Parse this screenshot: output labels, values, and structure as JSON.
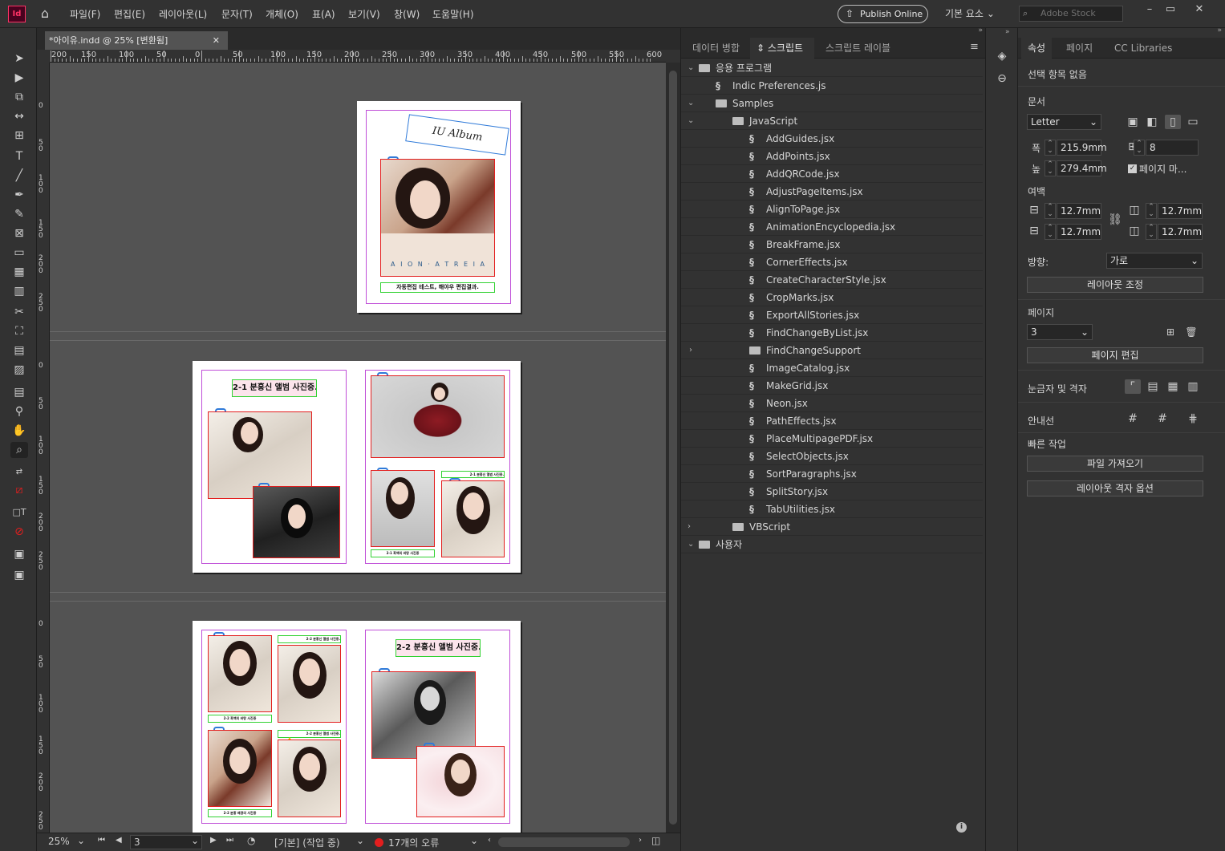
{
  "app": {
    "logo": "Id",
    "home_icon": "home-icon"
  },
  "menu": [
    "파일(F)",
    "편집(E)",
    "레이아웃(L)",
    "문자(T)",
    "개체(O)",
    "표(A)",
    "보기(V)",
    "창(W)",
    "도움말(H)"
  ],
  "publish_label": "Publish Online",
  "workspace_label": "기본 요소",
  "stock_placeholder": "Adobe Stock",
  "document": {
    "tab_title": "*아이유.indd @ 25% [변환됨]",
    "ruler_labels": [
      "200",
      "150",
      "100",
      "50",
      "0",
      "50",
      "100",
      "150",
      "200",
      "250",
      "300",
      "350",
      "400",
      "450",
      "500",
      "550",
      "600"
    ],
    "page1_title": "IU Album",
    "page1_caption_strip": "A I O N · A T R E I A",
    "page1_text": "자동편집 테스트, 해야우 편집결과.",
    "spread2_title": "2-1 분홍신 앨범 사진중...",
    "spread2_small_right": "2-1 분홍신 앨범 사진중.",
    "spread2_small_left": "2-1 흑백의 바탕 사진중",
    "spread3_title": "2-2 분홍신 앨범 사진중...",
    "spread3_small1": "2-2 분홍신 앨범 사진중.",
    "spread3_small2": "2-2 흑백의 바탕 사진중",
    "spread3_small3": "2-2 분홍신 앨범 사진중.",
    "spread3_small4": "2-2 분홍 배경의 사진중"
  },
  "status": {
    "zoom": "25%",
    "page": "3",
    "style": "[기본] (작업 중)",
    "errors": "17개의 오류",
    "error_color": "#e31e1e"
  },
  "scripts_panel": {
    "tabs": [
      "데이터 병합",
      "스크립트",
      "스크립트 레이블"
    ],
    "active_tab": "스크립트",
    "tree": [
      {
        "label": "응용 프로그램",
        "type": "folder",
        "level": 0,
        "expanded": true
      },
      {
        "label": "Indic Preferences.js",
        "type": "js",
        "level": 1
      },
      {
        "label": "Samples",
        "type": "folder",
        "level": 1,
        "expanded": true
      },
      {
        "label": "JavaScript",
        "type": "folder",
        "level": 2,
        "expanded": true
      },
      {
        "label": "AddGuides.jsx",
        "type": "js",
        "level": 3
      },
      {
        "label": "AddPoints.jsx",
        "type": "js",
        "level": 3
      },
      {
        "label": "AddQRCode.jsx",
        "type": "js",
        "level": 3
      },
      {
        "label": "AdjustPageItems.jsx",
        "type": "js",
        "level": 3
      },
      {
        "label": "AlignToPage.jsx",
        "type": "js",
        "level": 3
      },
      {
        "label": "AnimationEncyclopedia.jsx",
        "type": "js",
        "level": 3
      },
      {
        "label": "BreakFrame.jsx",
        "type": "js",
        "level": 3
      },
      {
        "label": "CornerEffects.jsx",
        "type": "js",
        "level": 3
      },
      {
        "label": "CreateCharacterStyle.jsx",
        "type": "js",
        "level": 3
      },
      {
        "label": "CropMarks.jsx",
        "type": "js",
        "level": 3
      },
      {
        "label": "ExportAllStories.jsx",
        "type": "js",
        "level": 3
      },
      {
        "label": "FindChangeByList.jsx",
        "type": "js",
        "level": 3
      },
      {
        "label": "FindChangeSupport",
        "type": "folder",
        "level": 3,
        "expanded": false
      },
      {
        "label": "ImageCatalog.jsx",
        "type": "js",
        "level": 3
      },
      {
        "label": "MakeGrid.jsx",
        "type": "js",
        "level": 3
      },
      {
        "label": "Neon.jsx",
        "type": "js",
        "level": 3
      },
      {
        "label": "PathEffects.jsx",
        "type": "js",
        "level": 3
      },
      {
        "label": "PlaceMultipagePDF.jsx",
        "type": "js",
        "level": 3
      },
      {
        "label": "SelectObjects.jsx",
        "type": "js",
        "level": 3
      },
      {
        "label": "SortParagraphs.jsx",
        "type": "js",
        "level": 3
      },
      {
        "label": "SplitStory.jsx",
        "type": "js",
        "level": 3
      },
      {
        "label": "TabUtilities.jsx",
        "type": "js",
        "level": 3
      },
      {
        "label": "VBScript",
        "type": "folder",
        "level": 2,
        "expanded": false
      },
      {
        "label": "사용자",
        "type": "folder",
        "level": 0,
        "expanded": true
      }
    ]
  },
  "properties": {
    "tabs": [
      "속성",
      "페이지",
      "CC Libraries"
    ],
    "no_selection": "선택 항목 없음",
    "document_label": "문서",
    "page_size": "Letter",
    "width_label": "폭",
    "width": "215.9mm",
    "height_label": "높",
    "height": "279.4mm",
    "pages_count": "8",
    "facing_pages_label": "페이지 마...",
    "margins_label": "여백",
    "margin_top": "12.7mm",
    "margin_bottom": "12.7mm",
    "margin_inside": "12.7mm",
    "margin_outside": "12.7mm",
    "orientation_label": "방향:",
    "orientation": "가로",
    "adjust_layout_btn": "레이아웃 조정",
    "page_label": "페이지",
    "page_value": "3",
    "edit_page_btn": "페이지 편집",
    "rulers_label": "눈금자 및 격자",
    "guides_label": "안내선",
    "quick_actions_label": "빠른 작업",
    "import_file_btn": "파일 가져오기",
    "layout_grid_btn": "레이아웃 격자 옵션"
  }
}
